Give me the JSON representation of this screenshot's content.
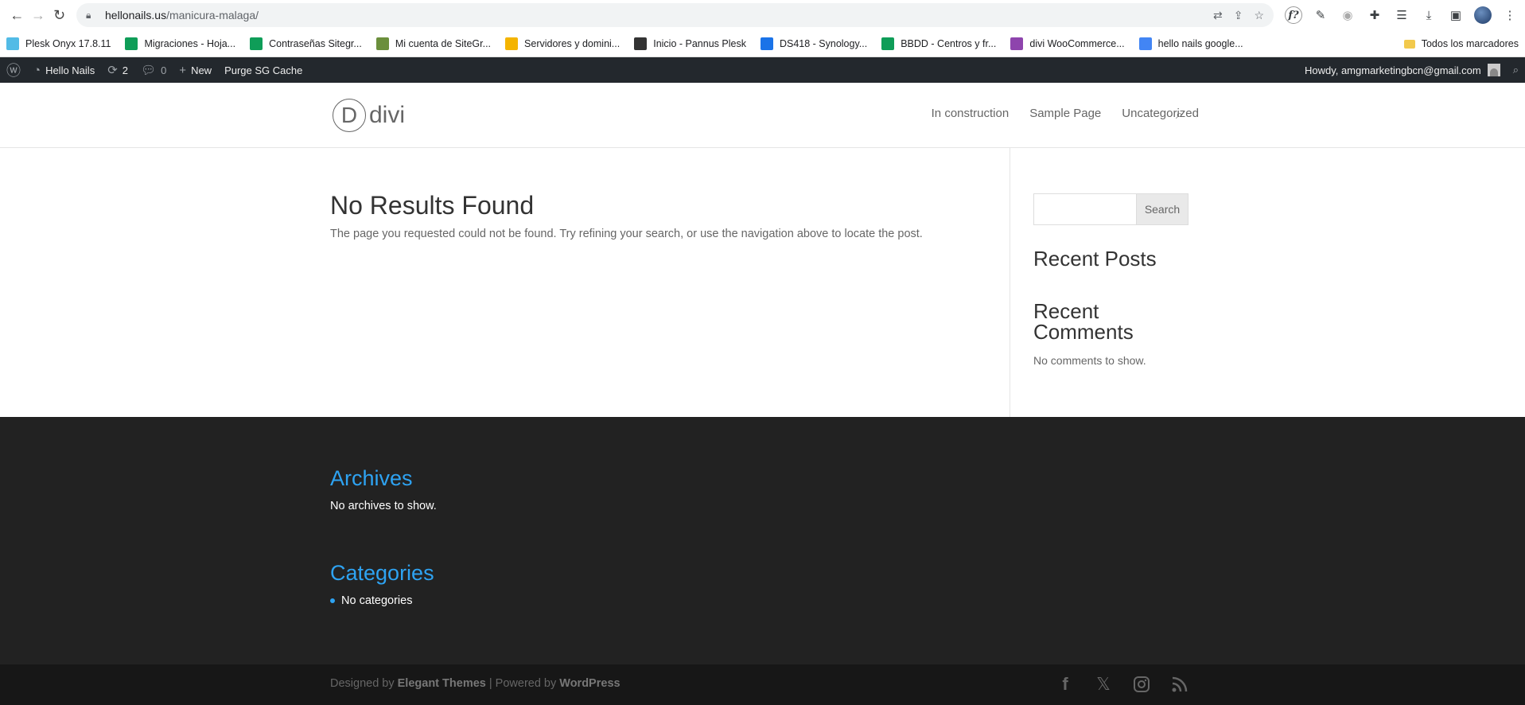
{
  "browser": {
    "url_host": "hellonails.us",
    "url_path": "/manicura-malaga/",
    "bookmarks": [
      {
        "label": "Plesk Onyx 17.8.11",
        "icon": "plesk-icon",
        "color": "#52bbe6"
      },
      {
        "label": "Migraciones - Hoja...",
        "icon": "sheets-icon",
        "color": "#0f9d58"
      },
      {
        "label": "Contraseñas Sitegr...",
        "icon": "sheets-icon",
        "color": "#0f9d58"
      },
      {
        "label": "Mi cuenta de SiteGr...",
        "icon": "siteground-icon",
        "color": "#6b8f3c"
      },
      {
        "label": "Servidores y domini...",
        "icon": "drive-icon",
        "color": "#f4b400"
      },
      {
        "label": "Inicio - Pannus Plesk",
        "icon": "pannus-icon",
        "color": "#333"
      },
      {
        "label": "DS418 - Synology...",
        "icon": "dsm-icon",
        "color": "#1a73e8"
      },
      {
        "label": "BBDD - Centros y fr...",
        "icon": "sheets-icon",
        "color": "#0f9d58"
      },
      {
        "label": "divi WooCommerce...",
        "icon": "divi-icon",
        "color": "#8e44ad"
      },
      {
        "label": "hello nails google...",
        "icon": "google-icon",
        "color": "#4285f4"
      }
    ],
    "all_bookmarks": "Todos los marcadores"
  },
  "adminbar": {
    "site_name": "Hello Nails",
    "updates_count": "2",
    "comments_count": "0",
    "new_label": "New",
    "purge_label": "Purge SG Cache",
    "howdy": "Howdy, amgmarketingbcn@gmail.com"
  },
  "header": {
    "logo_letter": "D",
    "logo_text": "divi",
    "nav": [
      "In construction",
      "Sample Page",
      "Uncategorized"
    ]
  },
  "main": {
    "title": "No Results Found",
    "text": "The page you requested could not be found. Try refining your search, or use the navigation above to locate the post."
  },
  "sidebar": {
    "search_button": "Search",
    "recent_posts": "Recent Posts",
    "recent_comments_line1": "Recent",
    "recent_comments_line2": "Comments",
    "no_comments": "No comments to show."
  },
  "footer": {
    "archives_title": "Archives",
    "archives_text": "No archives to show.",
    "categories_title": "Categories",
    "categories_text": "No categories",
    "designed_by": "Designed by ",
    "elegant": "Elegant Themes",
    "powered_by": " | Powered by ",
    "wordpress": "WordPress"
  },
  "colors": {
    "accent": "#2ea3f2",
    "adminbar": "#23282d",
    "footer": "#222222"
  }
}
